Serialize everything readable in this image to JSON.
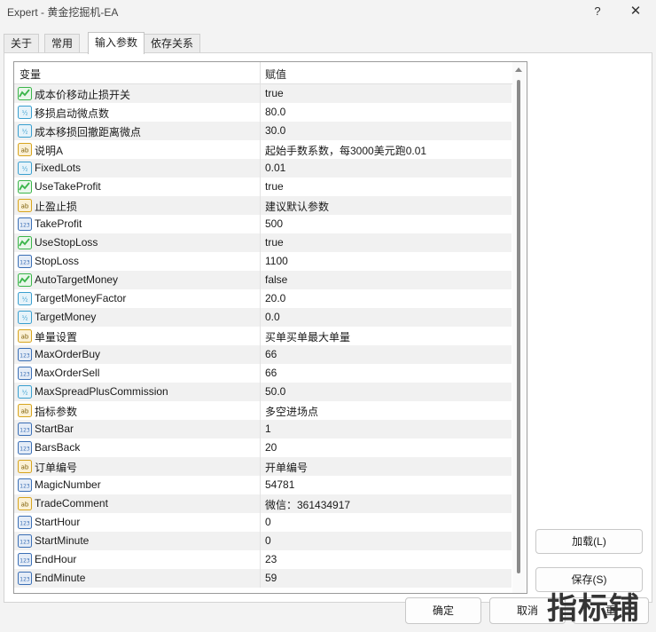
{
  "window": {
    "title": "Expert - 黄金挖掘机-EA",
    "help_icon": "?",
    "close_icon": "✕"
  },
  "tabs": [
    {
      "label": "关于",
      "active": false
    },
    {
      "label": "常用",
      "active": false
    },
    {
      "label": "输入参数",
      "active": true
    },
    {
      "label": "依存关系",
      "active": false
    }
  ],
  "grid": {
    "headers": {
      "variable": "变量",
      "value": "赋值"
    },
    "rows": [
      {
        "icon": "bool-icon",
        "name": "成本价移动止损开关",
        "value": "true"
      },
      {
        "icon": "double-icon",
        "name": "移损启动微点数",
        "value": "80.0"
      },
      {
        "icon": "double-icon",
        "name": "成本移损回撤距离微点",
        "value": "30.0"
      },
      {
        "icon": "string-icon",
        "name": "说明A",
        "value": "起始手数系数，每3000美元跑0.01"
      },
      {
        "icon": "double-icon",
        "name": "FixedLots",
        "value": "0.01"
      },
      {
        "icon": "bool-icon",
        "name": "UseTakeProfit",
        "value": "true"
      },
      {
        "icon": "string-icon",
        "name": "止盈止损",
        "value": "建议默认参数"
      },
      {
        "icon": "int-icon",
        "name": "TakeProfit",
        "value": "500"
      },
      {
        "icon": "bool-icon",
        "name": "UseStopLoss",
        "value": "true"
      },
      {
        "icon": "int-icon",
        "name": "StopLoss",
        "value": "1100"
      },
      {
        "icon": "bool-icon",
        "name": "AutoTargetMoney",
        "value": "false"
      },
      {
        "icon": "double-icon",
        "name": "TargetMoneyFactor",
        "value": "20.0"
      },
      {
        "icon": "double-icon",
        "name": "TargetMoney",
        "value": "0.0"
      },
      {
        "icon": "string-icon",
        "name": "单量设置",
        "value": "买单买单最大单量"
      },
      {
        "icon": "int-icon",
        "name": "MaxOrderBuy",
        "value": "66"
      },
      {
        "icon": "int-icon",
        "name": "MaxOrderSell",
        "value": "66"
      },
      {
        "icon": "double-icon",
        "name": "MaxSpreadPlusCommission",
        "value": "50.0"
      },
      {
        "icon": "string-icon",
        "name": "指标参数",
        "value": "多空进场点"
      },
      {
        "icon": "int-icon",
        "name": "StartBar",
        "value": "1"
      },
      {
        "icon": "int-icon",
        "name": "BarsBack",
        "value": "20"
      },
      {
        "icon": "string-icon",
        "name": "订单编号",
        "value": "开单编号"
      },
      {
        "icon": "int-icon",
        "name": "MagicNumber",
        "value": "54781"
      },
      {
        "icon": "string-icon",
        "name": "TradeComment",
        "value": "微信：361434917"
      },
      {
        "icon": "int-icon",
        "name": "StartHour",
        "value": "0"
      },
      {
        "icon": "int-icon",
        "name": "StartMinute",
        "value": "0"
      },
      {
        "icon": "int-icon",
        "name": "EndHour",
        "value": "23"
      },
      {
        "icon": "int-icon",
        "name": "EndMinute",
        "value": "59"
      }
    ]
  },
  "side_buttons": {
    "load": "加载(L)",
    "save": "保存(S)"
  },
  "footer_buttons": {
    "ok": "确定",
    "cancel": "取消",
    "reset": "重"
  },
  "watermark": "指标铺",
  "colors": {
    "bool": "#3bb54a",
    "double": "#3a9fcf",
    "string": "#d7a51f",
    "int": "#3b6fb5"
  }
}
